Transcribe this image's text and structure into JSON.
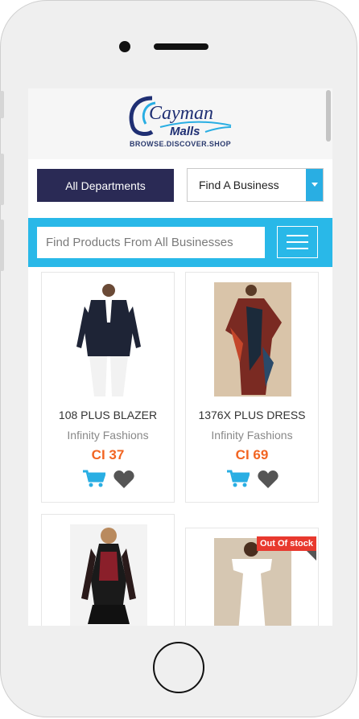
{
  "brand": {
    "logo_line1": "Cayman",
    "logo_line2": "Malls",
    "tagline": "BROWSE.DISCOVER.SHOP"
  },
  "nav": {
    "departments_label": "All Departments",
    "business_select_value": "Find A Business"
  },
  "search": {
    "placeholder": "Find Products From All Businesses"
  },
  "products": [
    {
      "title": "108 PLUS BLAZER",
      "shop": "Infinity Fashions",
      "price": "CI 37"
    },
    {
      "title": "1376X PLUS DRESS",
      "shop": "Infinity Fashions",
      "price": "CI 69"
    },
    {
      "title": "",
      "shop": "",
      "price": ""
    },
    {
      "title": "",
      "shop": "",
      "price": "",
      "badge": "Out Of stock"
    }
  ],
  "colors": {
    "accent_blue": "#29b8e8",
    "navy": "#2a2a55",
    "price_orange": "#f26522",
    "badge_red": "#e8392e"
  },
  "icons": [
    "cart-icon",
    "heart-icon",
    "hamburger-menu-icon",
    "chevron-down-icon"
  ]
}
